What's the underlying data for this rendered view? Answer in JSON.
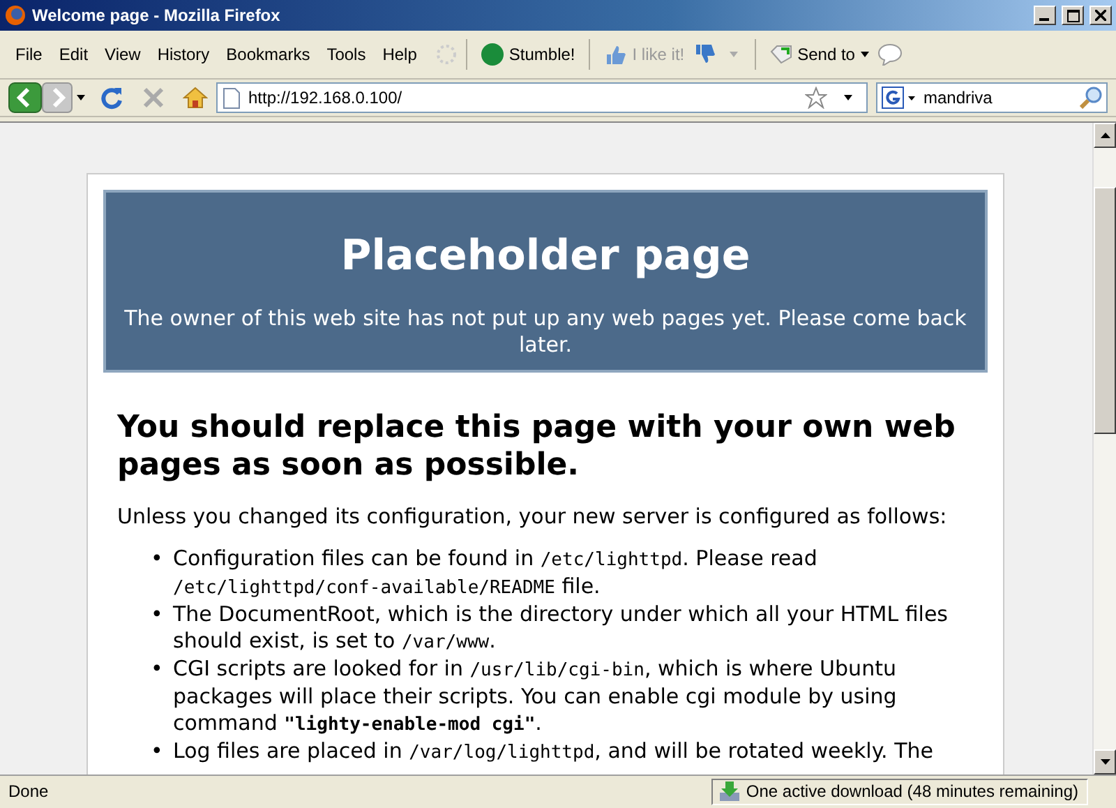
{
  "window": {
    "title": "Welcome page - Mozilla Firefox"
  },
  "menu": [
    "File",
    "Edit",
    "View",
    "History",
    "Bookmarks",
    "Tools",
    "Help"
  ],
  "toolbar": {
    "stumble": "Stumble!",
    "like": "I like it!",
    "send": "Send to"
  },
  "address": {
    "value": "http://192.168.0.100/"
  },
  "search": {
    "value": "mandriva"
  },
  "page": {
    "banner_title": "Placeholder page",
    "banner_text": "The owner of this web site has not put up any web pages yet. Please come back later.",
    "heading": "You should replace this page with your own web pages as soon as possible.",
    "intro": "Unless you changed its configuration, your new server is configured as follows:",
    "marker": "•",
    "bullets": [
      [
        {
          "kind": "text",
          "text": "Configuration files can be found in "
        },
        {
          "kind": "code",
          "text": "/etc/lighttpd"
        },
        {
          "kind": "text",
          "text": ". Please read "
        },
        {
          "kind": "code",
          "text": "/etc/lighttpd/conf-available/README"
        },
        {
          "kind": "text",
          "text": " file."
        }
      ],
      [
        {
          "kind": "text",
          "text": "The DocumentRoot, which is the directory under which all your HTML files should exist, is set to "
        },
        {
          "kind": "code",
          "text": "/var/www"
        },
        {
          "kind": "text",
          "text": "."
        }
      ],
      [
        {
          "kind": "text",
          "text": "CGI scripts are looked for in "
        },
        {
          "kind": "code",
          "text": "/usr/lib/cgi-bin"
        },
        {
          "kind": "text",
          "text": ", which is where Ubuntu packages will place their scripts. You can enable cgi module by using command "
        },
        {
          "kind": "strong",
          "text": "\"lighty-enable-mod cgi\""
        },
        {
          "kind": "text",
          "text": "."
        }
      ],
      [
        {
          "kind": "text",
          "text": "Log files are placed in "
        },
        {
          "kind": "code",
          "text": "/var/log/lighttpd"
        },
        {
          "kind": "text",
          "text": ", and will be rotated weekly. The"
        }
      ]
    ]
  },
  "status_bar": {
    "text": "Done",
    "download": "One active download (48 minutes remaining)"
  }
}
